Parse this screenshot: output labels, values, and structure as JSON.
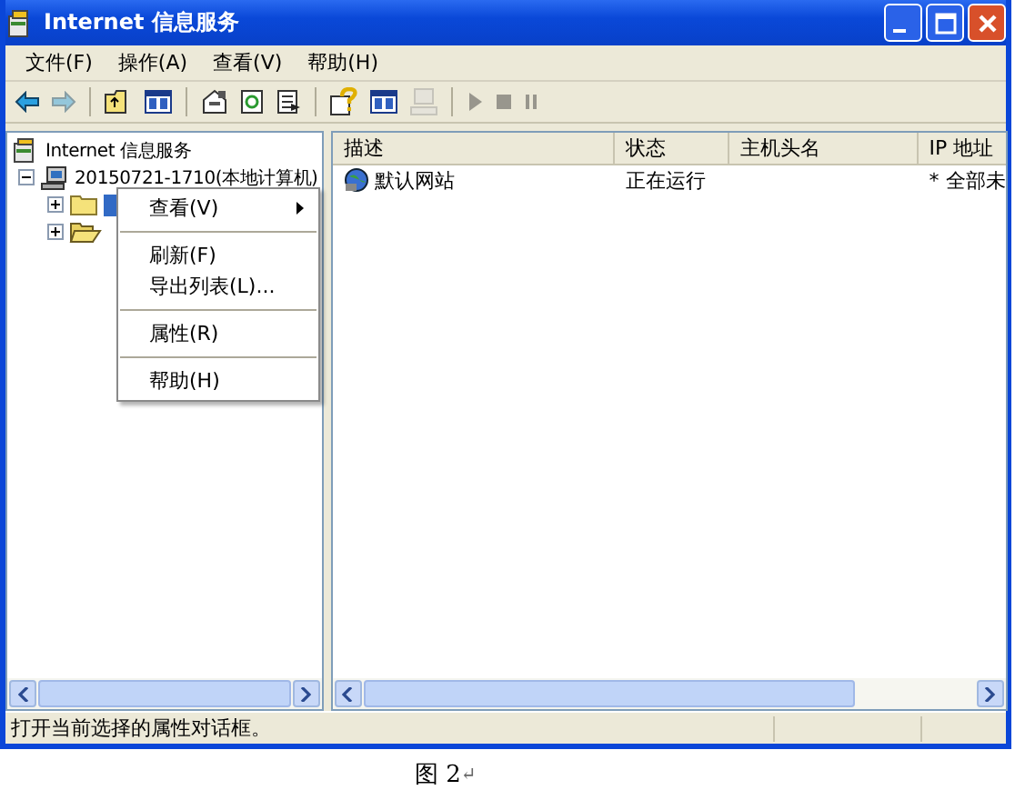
{
  "window": {
    "title": "Internet 信息服务"
  },
  "menu_bar": [
    "文件(F)",
    "操作(A)",
    "查看(V)",
    "帮助(H)"
  ],
  "toolbar": [
    {
      "kind": "back",
      "disabled": false
    },
    {
      "kind": "forward",
      "disabled": true
    },
    {
      "kind": "sep"
    },
    {
      "kind": "up",
      "disabled": false
    },
    {
      "kind": "pane",
      "disabled": false
    },
    {
      "kind": "sep"
    },
    {
      "kind": "properties",
      "disabled": false
    },
    {
      "kind": "refresh",
      "disabled": false
    },
    {
      "kind": "export",
      "disabled": false
    },
    {
      "kind": "sep"
    },
    {
      "kind": "help",
      "disabled": false
    },
    {
      "kind": "pane",
      "disabled": false
    },
    {
      "kind": "computer",
      "disabled": true
    },
    {
      "kind": "sep"
    },
    {
      "kind": "play",
      "disabled": true
    },
    {
      "kind": "stop",
      "disabled": true
    },
    {
      "kind": "pause",
      "disabled": true
    }
  ],
  "tree": {
    "label": "Internet 信息服务",
    "expanded": true,
    "children": [
      {
        "label": "20150721-1710(本地计算机)",
        "expanded": true,
        "children": [
          {
            "kind": "folder",
            "expanded": false,
            "selected": true
          },
          {
            "kind": "open-folder",
            "expanded": false,
            "selected": false
          }
        ]
      }
    ]
  },
  "context_menu": [
    {
      "kind": "item",
      "label": "查看(V)",
      "submenu": true
    },
    {
      "kind": "separator"
    },
    {
      "kind": "item",
      "label": "刷新(F)",
      "submenu": false
    },
    {
      "kind": "item",
      "label": "导出列表(L)...",
      "submenu": false
    },
    {
      "kind": "separator"
    },
    {
      "kind": "item",
      "label": "属性(R)",
      "submenu": false
    },
    {
      "kind": "separator"
    },
    {
      "kind": "item",
      "label": "帮助(H)",
      "submenu": false
    }
  ],
  "table": {
    "columns": [
      "描述",
      "状态",
      "主机头名",
      "IP 地址"
    ],
    "rows": [
      {
        "description": "默认网站",
        "status": "正在运行",
        "ip": "* 全部未"
      }
    ]
  },
  "status_bar": "打开当前选择的属性对话框。",
  "caption": {
    "text": "图 2",
    "mark": "↵"
  }
}
